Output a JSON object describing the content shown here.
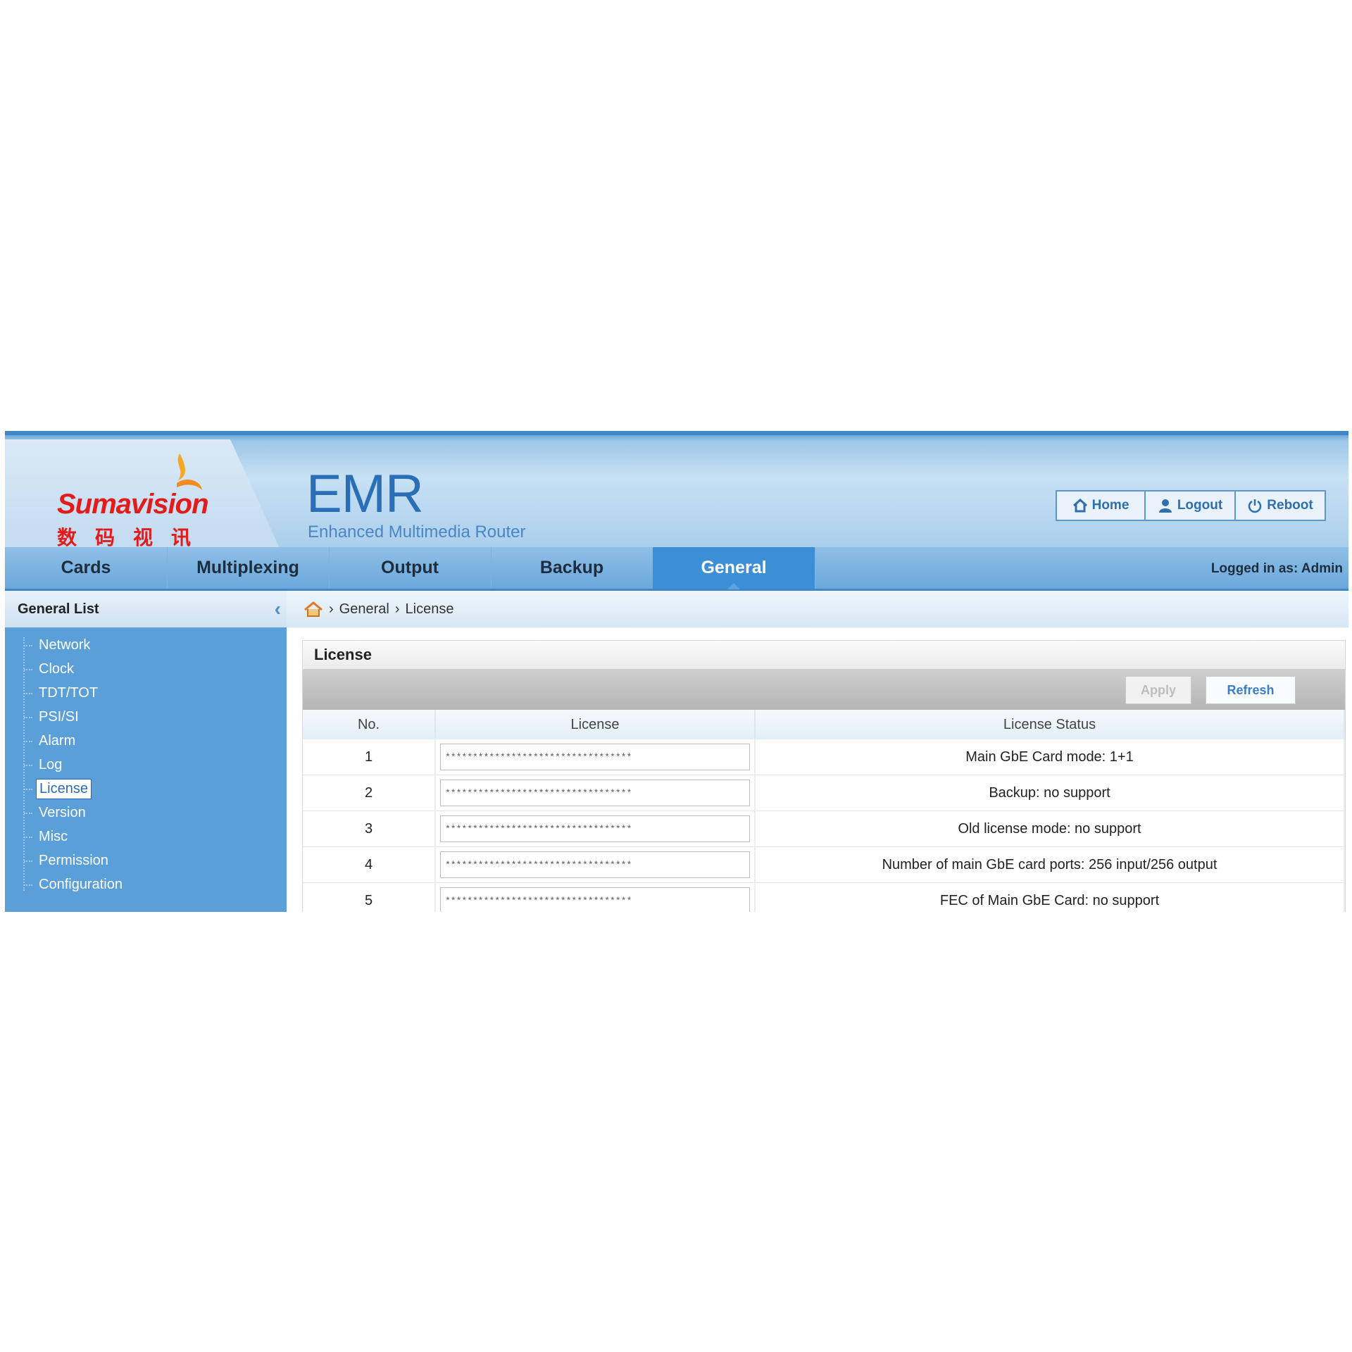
{
  "brand": {
    "logo_text": "Sumavision",
    "logo_cn": "数码视讯",
    "product_name": "EMR",
    "product_subtitle": "Enhanced Multimedia Router"
  },
  "top_buttons": {
    "home": "Home",
    "logout": "Logout",
    "reboot": "Reboot"
  },
  "nav": {
    "tabs": [
      "Cards",
      "Multiplexing",
      "Output",
      "Backup",
      "General"
    ],
    "active": "General",
    "login_info": "Logged in as: Admin"
  },
  "sidebar": {
    "title": "General List",
    "items": [
      "Network",
      "Clock",
      "TDT/TOT",
      "PSI/SI",
      "Alarm",
      "Log",
      "License",
      "Version",
      "Misc",
      "Permission",
      "Configuration"
    ],
    "selected": "License"
  },
  "breadcrumb": {
    "level1": "General",
    "level2": "License"
  },
  "panel": {
    "title": "License",
    "apply_label": "Apply",
    "refresh_label": "Refresh",
    "columns": [
      "No.",
      "License",
      "License Status"
    ],
    "rows": [
      {
        "no": "1",
        "license": "**********************************",
        "status": "Main GbE Card mode: 1+1"
      },
      {
        "no": "2",
        "license": "**********************************",
        "status": "Backup: no support"
      },
      {
        "no": "3",
        "license": "**********************************",
        "status": "Old license mode: no support"
      },
      {
        "no": "4",
        "license": "**********************************",
        "status": "Number of main GbE card ports: 256 input/256 output"
      },
      {
        "no": "5",
        "license": "**********************************",
        "status": "FEC of Main GbE Card: no support"
      }
    ]
  },
  "colors": {
    "accent": "#3c8fd6",
    "header": "#c7e0f4",
    "sidebar": "#5b9fd8",
    "brand_red": "#e21b1b"
  }
}
